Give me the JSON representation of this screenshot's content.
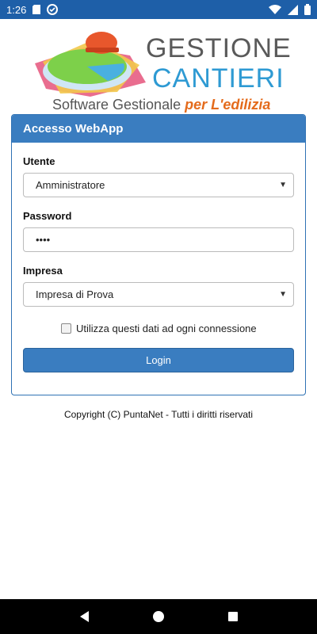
{
  "status_bar": {
    "time": "1:26",
    "icons": [
      "sd-card-icon",
      "vpn-icon",
      "wifi-icon",
      "signal-icon",
      "battery-icon"
    ]
  },
  "logo": {
    "title_line1": "GESTIONE",
    "title_line2": "CANTIERI",
    "subtitle_prefix": "Software Gestionale ",
    "subtitle_emphasis": "per L'edilizia"
  },
  "panel": {
    "header": "Accesso WebApp",
    "user_label": "Utente",
    "user_value": "Amministratore",
    "password_label": "Password",
    "password_value": "••••",
    "company_label": "Impresa",
    "company_value": "Impresa di Prova",
    "remember_label": "Utilizza questi dati ad ogni connessione",
    "login_label": "Login"
  },
  "footer": {
    "copyright": "Copyright (C) PuntaNet - Tutti i diritti riservati"
  },
  "colors": {
    "status_bar": "#1e5fa8",
    "panel_header": "#3a7dc0",
    "accent_orange": "#e46b1c",
    "accent_blue": "#2e9ad3"
  }
}
